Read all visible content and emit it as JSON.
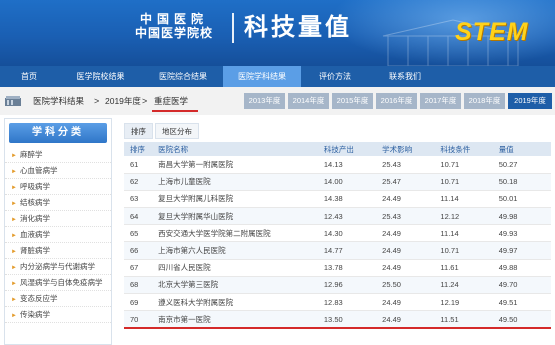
{
  "banner": {
    "logo_line1": "中国医院",
    "logo_line2": "中国医学院校",
    "title": "科技量值",
    "stem": "STEM"
  },
  "nav": {
    "items": [
      {
        "label": "首页"
      },
      {
        "label": "医学院校结果"
      },
      {
        "label": "医院综合结果"
      },
      {
        "label": "医院学科结果",
        "active": true
      },
      {
        "label": "评价方法"
      },
      {
        "label": "联系我们"
      }
    ]
  },
  "breadcrumb": {
    "items": [
      "医院学科结果",
      "2019年度",
      "重症医学"
    ],
    "separator": ">"
  },
  "years": [
    "2013年度",
    "2014年度",
    "2015年度",
    "2016年度",
    "2017年度",
    "2018年度",
    "2019年度"
  ],
  "active_year": "2019年度",
  "sidebar": {
    "title": "学科分类",
    "items": [
      "麻醉学",
      "心血管病学",
      "呼吸病学",
      "结核病学",
      "消化病学",
      "血液病学",
      "肾脏病学",
      "内分泌病学与代谢病学",
      "风湿病学与自体免疫病学",
      "变态反应学",
      "传染病学"
    ]
  },
  "tabs": [
    {
      "label": "排序",
      "active": true
    },
    {
      "label": "地区分布"
    }
  ],
  "table": {
    "headers": [
      "排序",
      "医院名称",
      "科技产出",
      "学术影响",
      "科技条件",
      "量值"
    ],
    "rows": [
      [
        "61",
        "南昌大学第一附属医院",
        "14.13",
        "25.43",
        "10.71",
        "50.27"
      ],
      [
        "62",
        "上海市儿童医院",
        "14.00",
        "25.47",
        "10.71",
        "50.18"
      ],
      [
        "63",
        "复旦大学附属儿科医院",
        "14.38",
        "24.49",
        "11.14",
        "50.01"
      ],
      [
        "64",
        "复旦大学附属华山医院",
        "12.43",
        "25.43",
        "12.12",
        "49.98"
      ],
      [
        "65",
        "西安交通大学医学院第二附属医院",
        "14.30",
        "24.49",
        "11.14",
        "49.93"
      ],
      [
        "66",
        "上海市第六人民医院",
        "14.77",
        "24.49",
        "10.71",
        "49.97"
      ],
      [
        "67",
        "四川省人民医院",
        "13.78",
        "24.49",
        "11.61",
        "49.88"
      ],
      [
        "68",
        "北京大学第三医院",
        "12.96",
        "25.50",
        "11.24",
        "49.70"
      ],
      [
        "69",
        "遵义医科大学附属医院",
        "12.83",
        "24.49",
        "12.19",
        "49.51"
      ],
      [
        "70",
        "南京市第一医院",
        "13.50",
        "24.49",
        "11.51",
        "49.50"
      ]
    ]
  },
  "colors": {
    "banner": "#1a5fb3",
    "nav": "#1e5ea8",
    "nav_active": "#5b9ee6",
    "highlight_underline": "#d42a2a",
    "stem": "#ffd21a"
  }
}
